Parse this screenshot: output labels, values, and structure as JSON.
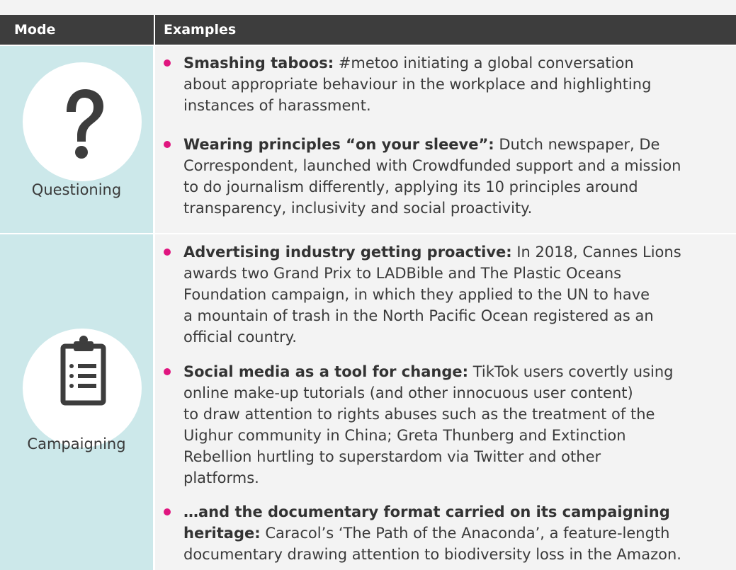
{
  "table": {
    "headers": {
      "mode": "Mode",
      "examples": "Examples"
    },
    "rows": [
      {
        "mode": "Questioning",
        "icon": "question-mark-icon",
        "examples": [
          {
            "bold": "Smashing taboos:",
            "lines": [
              " #metoo initiating a global conversation",
              "about appropriate behaviour in the workplace and highlighting",
              "instances of harassment."
            ]
          },
          {
            "bold": "Wearing principles “on your sleeve”:",
            "lines": [
              " Dutch newspaper, De",
              "Correspondent, launched with Crowdfunded support and a mission",
              "to do journalism differently, applying its 10 principles around",
              "transparency, inclusivity and social proactivity."
            ]
          }
        ]
      },
      {
        "mode": "Campaigning",
        "icon": "clipboard-list-icon",
        "examples": [
          {
            "bold": "Advertising industry getting proactive:",
            "lines": [
              " In 2018, Cannes Lions",
              "awards two Grand Prix to LADBible and The Plastic Oceans",
              "Foundation campaign, in which they applied to the UN to have",
              "a mountain of trash in the North Pacific Ocean registered as an",
              "official country."
            ]
          },
          {
            "bold": "Social media as a tool for change:",
            "lines": [
              " TikTok users covertly using",
              "online make-up tutorials (and other innocuous user content)",
              "to draw attention to rights abuses such as the treatment of the",
              "Uighur community in China; Greta Thunberg and Extinction",
              "Rebellion hurtling to superstardom via Twitter and other",
              "platforms."
            ]
          },
          {
            "bold": "…and the documentary format carried on its campaigning",
            "bold2": "heritage:",
            "lines": [
              "",
              " Caracol’s ‘The Path of the Anaconda’, a feature-length",
              "documentary drawing attention to biodiversity loss in the Amazon."
            ]
          }
        ]
      }
    ]
  },
  "colors": {
    "header_bg": "#3d3d3d",
    "mode_bg": "#cce8ea",
    "bullet": "#e0157f",
    "page_bg": "#f3f3f3"
  }
}
